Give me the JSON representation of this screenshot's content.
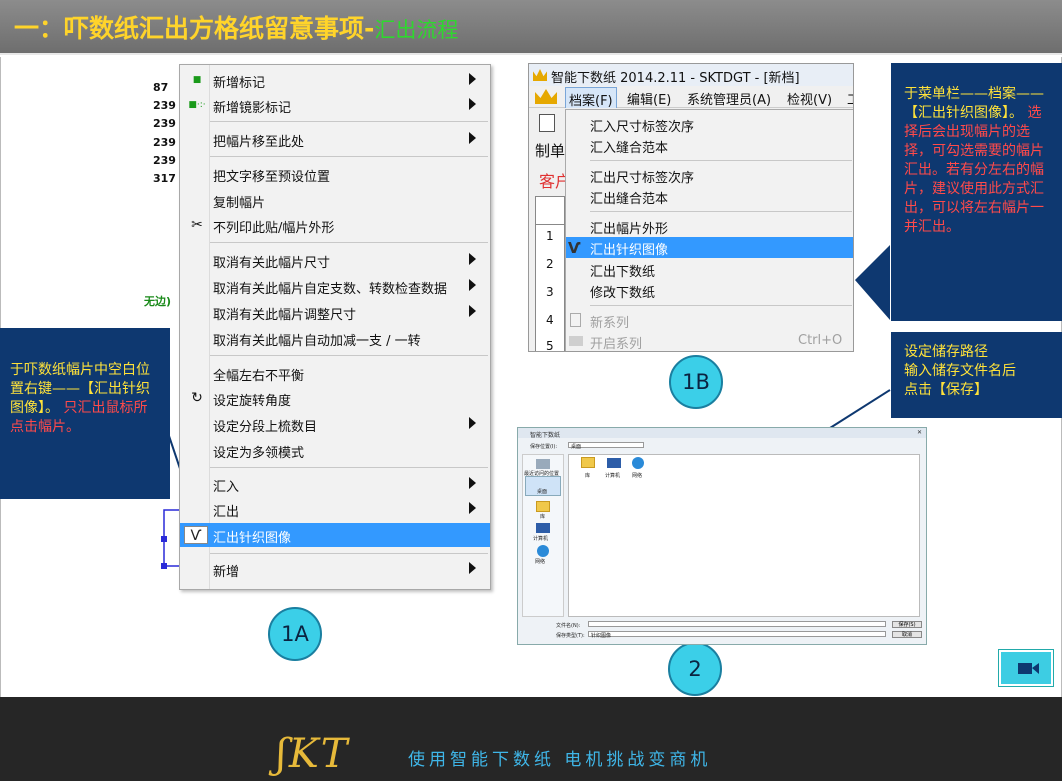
{
  "header": {
    "title": "一：吓数纸汇出方格纸留意事项-",
    "subtitle": "汇出流程"
  },
  "left_numbers": [
    "87",
    "239",
    "239",
    "239",
    "239",
    "317"
  ],
  "wubian_label": "无边)",
  "context_menu": {
    "items": [
      {
        "label": "新增标记",
        "icon": "■",
        "submenu": true
      },
      {
        "label": "新增镜影标记",
        "icon": "■·:·",
        "submenu": true
      },
      {
        "label": "把幅片移至此处",
        "icon": "",
        "submenu": true
      },
      {
        "label": "把文字移至预设位置",
        "icon": "",
        "submenu": false
      },
      {
        "label": "复制幅片",
        "icon": "",
        "submenu": false
      },
      {
        "label": "不列印此贴/幅片外形",
        "icon": "✂",
        "submenu": false
      },
      {
        "label": "取消有关此幅片尺寸",
        "icon": "",
        "submenu": true
      },
      {
        "label": "取消有关此幅片自定支数、转数检查数据",
        "icon": "",
        "submenu": true
      },
      {
        "label": "取消有关此幅片调整尺寸",
        "icon": "",
        "submenu": true
      },
      {
        "label": "取消有关此幅片自动加减一支 / 一转",
        "icon": "",
        "submenu": false
      },
      {
        "label": "全幅左右不平衡",
        "icon": "",
        "submenu": false
      },
      {
        "label": "设定旋转角度",
        "icon": "↻",
        "submenu": false
      },
      {
        "label": "设定分段上梳数目",
        "icon": "",
        "submenu": true
      },
      {
        "label": "设定为多领模式",
        "icon": "",
        "submenu": false
      },
      {
        "label": "汇入",
        "icon": "",
        "submenu": true
      },
      {
        "label": "汇出",
        "icon": "",
        "submenu": true
      },
      {
        "label": "汇出针织图像",
        "icon": "Ѵ",
        "submenu": false
      },
      {
        "label": "新增",
        "icon": "",
        "submenu": true
      }
    ]
  },
  "callout_1a": {
    "text": "于吓数纸幅片中空白位置右键——【汇出针织图像】。",
    "red_text": "只汇出鼠标所点击幅片。"
  },
  "window_1b": {
    "title": "智能下数纸 2014.2.11 - SKTDGT - [新档]",
    "menubar": [
      "档案(F)",
      "编辑(E)",
      "系统管理员(A)",
      "检视(V)",
      "工"
    ],
    "behind_text": [
      "制单",
      "客户"
    ],
    "row_numbers": [
      "1",
      "2",
      "3",
      "4",
      "5"
    ],
    "dropdown": [
      {
        "label": "汇入尺寸标签次序"
      },
      {
        "label": "汇入缝合范本"
      },
      {
        "label": "汇出尺寸标签次序"
      },
      {
        "label": "汇出缝合范本"
      },
      {
        "label": "汇出幅片外形"
      },
      {
        "label": "汇出针织图像"
      },
      {
        "label": "汇出下数纸"
      },
      {
        "label": "修改下数纸"
      },
      {
        "label": "新系列"
      },
      {
        "label": "开启系列",
        "shortcut": "Ctrl+O"
      }
    ]
  },
  "callout_1b": {
    "text": "于菜单栏——档案——【汇出针织图像】。",
    "red_text": "选择后会出现幅片的选择，可勾选需要的幅片汇出。若有分左右的幅片，建议使用此方式汇出，可以将左右幅片一并汇出。"
  },
  "callout_2": {
    "line1": "设定储存路径",
    "line2": "输入储存文件名后",
    "line3": "点击【保存】"
  },
  "labels": {
    "c1a": "1A",
    "c1b": "1B",
    "c2": "2"
  },
  "dialog_2": {
    "title": "智能下数纸",
    "save_in_label": "保存位置(I):",
    "save_in_value": "桌面",
    "sidebar": [
      "最近访问的位置",
      "桌面",
      "库",
      "计算机",
      "网络"
    ],
    "files": [
      "库",
      "计算机",
      "网络"
    ],
    "filename_label": "文件名(N):",
    "filetype_label": "保存类型(T):",
    "filetype_value": "针织图像",
    "save_button": "保存(S)",
    "cancel_button": "取消"
  },
  "footer": {
    "logo": "ʃKT",
    "slogan": "使用智能下数纸  电机挑战变商机"
  },
  "colors": {
    "accent_yellow": "#ffd42a",
    "callout_bg": "#0e3870",
    "highlight": "#3399ff",
    "circle": "#3bcfe8"
  }
}
